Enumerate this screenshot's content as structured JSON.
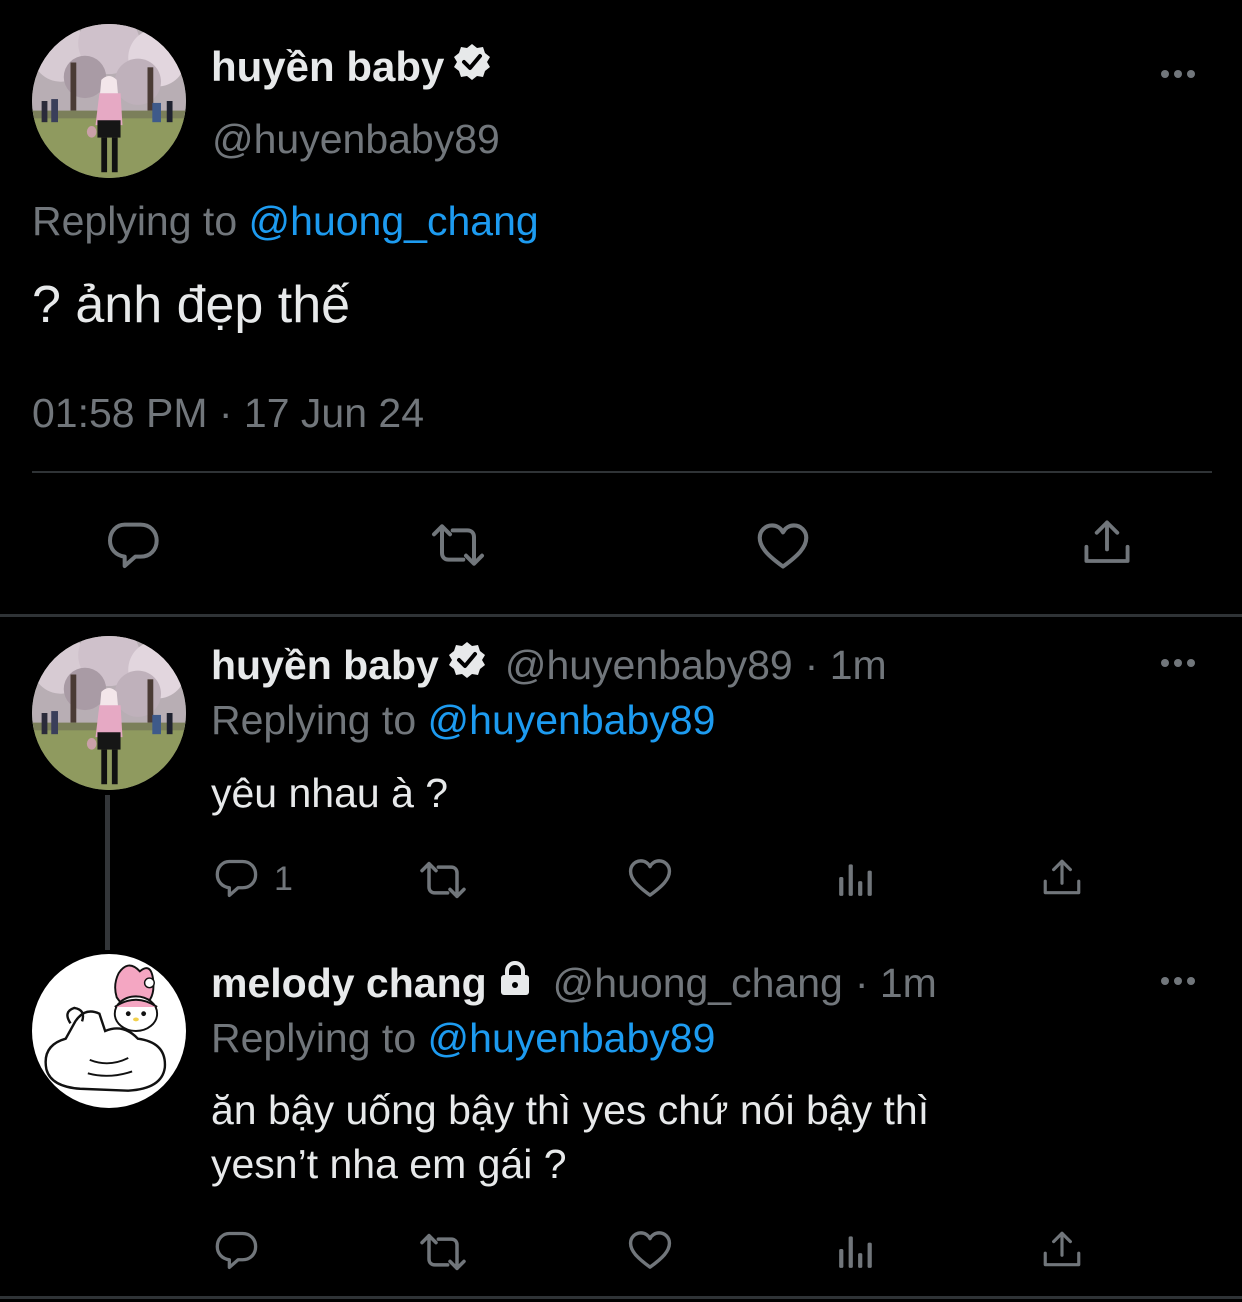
{
  "main_tweet": {
    "display_name": "huyền baby",
    "handle": "@huyenbaby89",
    "replying_prefix": "Replying to",
    "replying_to": "@huong_chang",
    "text": "? ảnh đẹp thế",
    "timestamp": "01:58 PM · 17 Jun 24"
  },
  "replies": [
    {
      "display_name": "huyền baby",
      "handle": "@huyenbaby89",
      "time": "· 1m",
      "replying_prefix": "Replying to",
      "replying_to": "@huyenbaby89",
      "text": "yêu nhau à ?",
      "reply_count": "1",
      "badge": "verified"
    },
    {
      "display_name": "melody chang",
      "handle": "@huong_chang",
      "time": "· 1m",
      "replying_prefix": "Replying to",
      "replying_to": "@huyenbaby89",
      "text_line1": "ăn bậy uống bậy thì yes chứ nói bậy thì",
      "text_line2": "yesn’t nha em gái ?",
      "badge": "protected-lock"
    }
  ],
  "colors": {
    "background": "#000000",
    "text": "#e7e9ea",
    "muted": "#71767b",
    "link": "#1d9bf0",
    "divider": "#2f3336"
  },
  "icons": [
    "comment-icon",
    "retweet-icon",
    "like-icon",
    "share-icon",
    "analytics-icon",
    "more-icon",
    "verified-icon",
    "lock-icon"
  ]
}
